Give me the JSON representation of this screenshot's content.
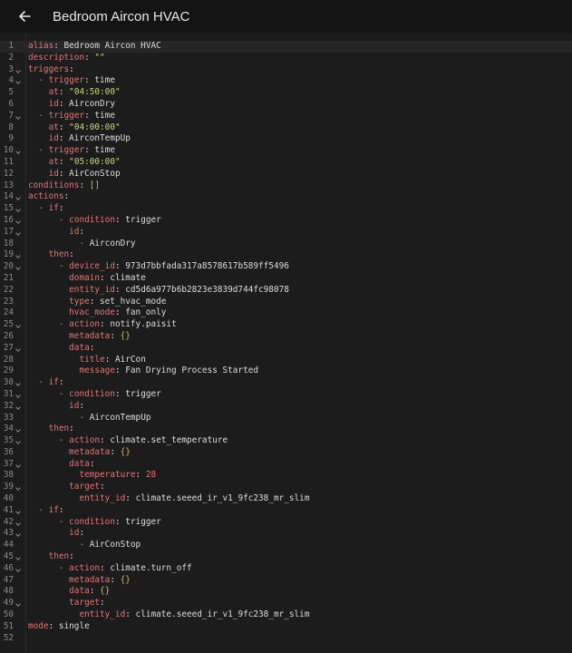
{
  "header": {
    "title": "Bedroom Aircon HVAC",
    "back_icon": "arrow-left-icon"
  },
  "colors": {
    "background": "#1c1c1c",
    "header_bg": "#141414",
    "key": "#e57373",
    "string": "#c9d57a",
    "plain": "#dcdcdc",
    "line_number": "#8a8a8a"
  },
  "editor": {
    "lines": [
      {
        "n": "1",
        "fold": false,
        "tokens": [
          [
            "k",
            "alias"
          ],
          [
            "t",
            ": Bedroom Aircon HVAC"
          ]
        ]
      },
      {
        "n": "2",
        "fold": false,
        "tokens": [
          [
            "k",
            "description"
          ],
          [
            "t",
            ": "
          ],
          [
            "s",
            "\"\""
          ]
        ]
      },
      {
        "n": "3",
        "fold": true,
        "tokens": [
          [
            "k",
            "triggers"
          ],
          [
            "t",
            ":"
          ]
        ]
      },
      {
        "n": "4",
        "fold": true,
        "tokens": [
          [
            "t",
            "  "
          ],
          [
            "d",
            "- "
          ],
          [
            "k",
            "trigger"
          ],
          [
            "t",
            ": time"
          ]
        ]
      },
      {
        "n": "5",
        "fold": false,
        "tokens": [
          [
            "t",
            "    "
          ],
          [
            "k",
            "at"
          ],
          [
            "t",
            ": "
          ],
          [
            "s",
            "\"04:50:00\""
          ]
        ]
      },
      {
        "n": "6",
        "fold": false,
        "tokens": [
          [
            "t",
            "    "
          ],
          [
            "k",
            "id"
          ],
          [
            "t",
            ": AirconDry"
          ]
        ]
      },
      {
        "n": "7",
        "fold": true,
        "tokens": [
          [
            "t",
            "  "
          ],
          [
            "d",
            "- "
          ],
          [
            "k",
            "trigger"
          ],
          [
            "t",
            ": time"
          ]
        ]
      },
      {
        "n": "8",
        "fold": false,
        "tokens": [
          [
            "t",
            "    "
          ],
          [
            "k",
            "at"
          ],
          [
            "t",
            ": "
          ],
          [
            "s",
            "\"04:00:00\""
          ]
        ]
      },
      {
        "n": "9",
        "fold": false,
        "tokens": [
          [
            "t",
            "    "
          ],
          [
            "k",
            "id"
          ],
          [
            "t",
            ": AirconTempUp"
          ]
        ]
      },
      {
        "n": "10",
        "fold": true,
        "tokens": [
          [
            "t",
            "  "
          ],
          [
            "d",
            "- "
          ],
          [
            "k",
            "trigger"
          ],
          [
            "t",
            ": time"
          ]
        ]
      },
      {
        "n": "11",
        "fold": false,
        "tokens": [
          [
            "t",
            "    "
          ],
          [
            "k",
            "at"
          ],
          [
            "t",
            ": "
          ],
          [
            "s",
            "\"05:00:00\""
          ]
        ]
      },
      {
        "n": "12",
        "fold": false,
        "tokens": [
          [
            "t",
            "    "
          ],
          [
            "k",
            "id"
          ],
          [
            "t",
            ": AirConStop"
          ]
        ]
      },
      {
        "n": "13",
        "fold": false,
        "tokens": [
          [
            "k",
            "conditions"
          ],
          [
            "t",
            ": "
          ],
          [
            "p",
            "[]"
          ]
        ]
      },
      {
        "n": "14",
        "fold": true,
        "tokens": [
          [
            "k",
            "actions"
          ],
          [
            "t",
            ":"
          ]
        ]
      },
      {
        "n": "15",
        "fold": true,
        "tokens": [
          [
            "t",
            "  "
          ],
          [
            "d",
            "- "
          ],
          [
            "k",
            "if"
          ],
          [
            "t",
            ":"
          ]
        ]
      },
      {
        "n": "16",
        "fold": true,
        "tokens": [
          [
            "t",
            "      "
          ],
          [
            "d",
            "- "
          ],
          [
            "k",
            "condition"
          ],
          [
            "t",
            ": trigger"
          ]
        ]
      },
      {
        "n": "17",
        "fold": true,
        "tokens": [
          [
            "t",
            "        "
          ],
          [
            "k",
            "id"
          ],
          [
            "t",
            ":"
          ]
        ]
      },
      {
        "n": "18",
        "fold": false,
        "tokens": [
          [
            "t",
            "          "
          ],
          [
            "d",
            "- "
          ],
          [
            "t",
            "AirconDry"
          ]
        ]
      },
      {
        "n": "19",
        "fold": true,
        "tokens": [
          [
            "t",
            "    "
          ],
          [
            "k",
            "then"
          ],
          [
            "t",
            ":"
          ]
        ]
      },
      {
        "n": "20",
        "fold": true,
        "tokens": [
          [
            "t",
            "      "
          ],
          [
            "d",
            "- "
          ],
          [
            "k",
            "device_id"
          ],
          [
            "t",
            ": 973d7bbfada317a8578617b589ff5496"
          ]
        ]
      },
      {
        "n": "21",
        "fold": false,
        "tokens": [
          [
            "t",
            "        "
          ],
          [
            "k",
            "domain"
          ],
          [
            "t",
            ": climate"
          ]
        ]
      },
      {
        "n": "22",
        "fold": false,
        "tokens": [
          [
            "t",
            "        "
          ],
          [
            "k",
            "entity_id"
          ],
          [
            "t",
            ": cd5d6a977b6b2823e3839d744fc98078"
          ]
        ]
      },
      {
        "n": "23",
        "fold": false,
        "tokens": [
          [
            "t",
            "        "
          ],
          [
            "k",
            "type"
          ],
          [
            "t",
            ": set_hvac_mode"
          ]
        ]
      },
      {
        "n": "24",
        "fold": false,
        "tokens": [
          [
            "t",
            "        "
          ],
          [
            "k",
            "hvac_mode"
          ],
          [
            "t",
            ": fan_only"
          ]
        ]
      },
      {
        "n": "25",
        "fold": true,
        "tokens": [
          [
            "t",
            "      "
          ],
          [
            "d",
            "- "
          ],
          [
            "k",
            "action"
          ],
          [
            "t",
            ": notify.paisit"
          ]
        ]
      },
      {
        "n": "26",
        "fold": false,
        "tokens": [
          [
            "t",
            "        "
          ],
          [
            "k",
            "metadata"
          ],
          [
            "t",
            ": "
          ],
          [
            "p",
            "{}"
          ]
        ]
      },
      {
        "n": "27",
        "fold": true,
        "tokens": [
          [
            "t",
            "        "
          ],
          [
            "k",
            "data"
          ],
          [
            "t",
            ":"
          ]
        ]
      },
      {
        "n": "28",
        "fold": false,
        "tokens": [
          [
            "t",
            "          "
          ],
          [
            "k",
            "title"
          ],
          [
            "t",
            ": AirCon"
          ]
        ]
      },
      {
        "n": "29",
        "fold": false,
        "tokens": [
          [
            "t",
            "          "
          ],
          [
            "k",
            "message"
          ],
          [
            "t",
            ": Fan Drying Process Started"
          ]
        ]
      },
      {
        "n": "30",
        "fold": true,
        "tokens": [
          [
            "t",
            "  "
          ],
          [
            "d",
            "- "
          ],
          [
            "k",
            "if"
          ],
          [
            "t",
            ":"
          ]
        ]
      },
      {
        "n": "31",
        "fold": true,
        "tokens": [
          [
            "t",
            "      "
          ],
          [
            "d",
            "- "
          ],
          [
            "k",
            "condition"
          ],
          [
            "t",
            ": trigger"
          ]
        ]
      },
      {
        "n": "32",
        "fold": true,
        "tokens": [
          [
            "t",
            "        "
          ],
          [
            "k",
            "id"
          ],
          [
            "t",
            ":"
          ]
        ]
      },
      {
        "n": "33",
        "fold": false,
        "tokens": [
          [
            "t",
            "          "
          ],
          [
            "d",
            "- "
          ],
          [
            "t",
            "AirconTempUp"
          ]
        ]
      },
      {
        "n": "34",
        "fold": true,
        "tokens": [
          [
            "t",
            "    "
          ],
          [
            "k",
            "then"
          ],
          [
            "t",
            ":"
          ]
        ]
      },
      {
        "n": "35",
        "fold": true,
        "tokens": [
          [
            "t",
            "      "
          ],
          [
            "d",
            "- "
          ],
          [
            "k",
            "action"
          ],
          [
            "t",
            ": climate.set_temperature"
          ]
        ]
      },
      {
        "n": "36",
        "fold": false,
        "tokens": [
          [
            "t",
            "        "
          ],
          [
            "k",
            "metadata"
          ],
          [
            "t",
            ": "
          ],
          [
            "p",
            "{}"
          ]
        ]
      },
      {
        "n": "37",
        "fold": true,
        "tokens": [
          [
            "t",
            "        "
          ],
          [
            "k",
            "data"
          ],
          [
            "t",
            ":"
          ]
        ]
      },
      {
        "n": "38",
        "fold": false,
        "tokens": [
          [
            "t",
            "          "
          ],
          [
            "k",
            "temperature"
          ],
          [
            "t",
            ": "
          ],
          [
            "n",
            "28"
          ]
        ]
      },
      {
        "n": "39",
        "fold": true,
        "tokens": [
          [
            "t",
            "        "
          ],
          [
            "k",
            "target"
          ],
          [
            "t",
            ":"
          ]
        ]
      },
      {
        "n": "40",
        "fold": false,
        "tokens": [
          [
            "t",
            "          "
          ],
          [
            "k",
            "entity_id"
          ],
          [
            "t",
            ": climate.seeed_ir_v1_9fc238_mr_slim"
          ]
        ]
      },
      {
        "n": "41",
        "fold": true,
        "tokens": [
          [
            "t",
            "  "
          ],
          [
            "d",
            "- "
          ],
          [
            "k",
            "if"
          ],
          [
            "t",
            ":"
          ]
        ]
      },
      {
        "n": "42",
        "fold": true,
        "tokens": [
          [
            "t",
            "      "
          ],
          [
            "d",
            "- "
          ],
          [
            "k",
            "condition"
          ],
          [
            "t",
            ": trigger"
          ]
        ]
      },
      {
        "n": "43",
        "fold": true,
        "tokens": [
          [
            "t",
            "        "
          ],
          [
            "k",
            "id"
          ],
          [
            "t",
            ":"
          ]
        ]
      },
      {
        "n": "44",
        "fold": false,
        "tokens": [
          [
            "t",
            "          "
          ],
          [
            "d",
            "- "
          ],
          [
            "t",
            "AirConStop"
          ]
        ]
      },
      {
        "n": "45",
        "fold": true,
        "tokens": [
          [
            "t",
            "    "
          ],
          [
            "k",
            "then"
          ],
          [
            "t",
            ":"
          ]
        ]
      },
      {
        "n": "46",
        "fold": true,
        "tokens": [
          [
            "t",
            "      "
          ],
          [
            "d",
            "- "
          ],
          [
            "k",
            "action"
          ],
          [
            "t",
            ": climate.turn_off"
          ]
        ]
      },
      {
        "n": "47",
        "fold": false,
        "tokens": [
          [
            "t",
            "        "
          ],
          [
            "k",
            "metadata"
          ],
          [
            "t",
            ": "
          ],
          [
            "p",
            "{}"
          ]
        ]
      },
      {
        "n": "48",
        "fold": false,
        "tokens": [
          [
            "t",
            "        "
          ],
          [
            "k",
            "data"
          ],
          [
            "t",
            ": "
          ],
          [
            "p",
            "{}"
          ]
        ]
      },
      {
        "n": "49",
        "fold": true,
        "tokens": [
          [
            "t",
            "        "
          ],
          [
            "k",
            "target"
          ],
          [
            "t",
            ":"
          ]
        ]
      },
      {
        "n": "50",
        "fold": false,
        "tokens": [
          [
            "t",
            "          "
          ],
          [
            "k",
            "entity_id"
          ],
          [
            "t",
            ": climate.seeed_ir_v1_9fc238_mr_slim"
          ]
        ]
      },
      {
        "n": "51",
        "fold": false,
        "tokens": [
          [
            "k",
            "mode"
          ],
          [
            "t",
            ": single"
          ]
        ]
      },
      {
        "n": "52",
        "fold": false,
        "tokens": []
      }
    ]
  }
}
